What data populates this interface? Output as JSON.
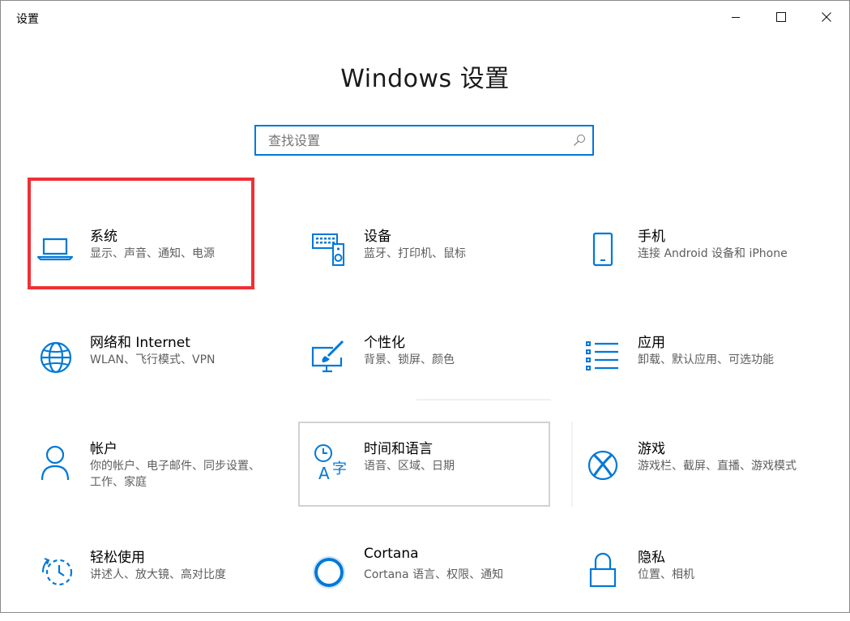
{
  "window": {
    "title": "设置",
    "controls": {
      "minimize_icon": "minimize-icon",
      "maximize_icon": "maximize-icon",
      "close_icon": "close-icon"
    }
  },
  "heading": "Windows 设置",
  "search": {
    "placeholder": "查找设置",
    "value": "",
    "icon": "search-icon"
  },
  "tiles": [
    {
      "name": "系统",
      "desc": "显示、声音、通知、电源",
      "icon": "laptop-icon"
    },
    {
      "name": "设备",
      "desc": "蓝牙、打印机、鼠标",
      "icon": "keyboard-speaker-icon"
    },
    {
      "name": "手机",
      "desc": "连接 Android 设备和 iPhone",
      "icon": "phone-icon"
    },
    {
      "name": "网络和 Internet",
      "desc": "WLAN、飞行模式、VPN",
      "icon": "globe-icon"
    },
    {
      "name": "个性化",
      "desc": "背景、锁屏、颜色",
      "icon": "paint-brush-icon"
    },
    {
      "name": "应用",
      "desc": "卸载、默认应用、可选功能",
      "icon": "apps-list-icon"
    },
    {
      "name": "帐户",
      "desc": "你的帐户、电子邮件、同步设置、工作、家庭",
      "icon": "person-icon"
    },
    {
      "name": "时间和语言",
      "desc": "语音、区域、日期",
      "icon": "time-language-icon"
    },
    {
      "name": "游戏",
      "desc": "游戏栏、截屏、直播、游戏模式",
      "icon": "xbox-icon"
    },
    {
      "name": "轻松使用",
      "desc": "讲述人、放大镜、高对比度",
      "icon": "ease-of-access-icon"
    },
    {
      "name": "Cortana",
      "desc": "Cortana 语言、权限、通知",
      "icon": "cortana-icon"
    },
    {
      "name": "隐私",
      "desc": "位置、相机",
      "icon": "lock-icon"
    }
  ],
  "colors": {
    "accent": "#0078d7",
    "highlight": "#ef3034",
    "desc_text": "#5d5d5d"
  }
}
